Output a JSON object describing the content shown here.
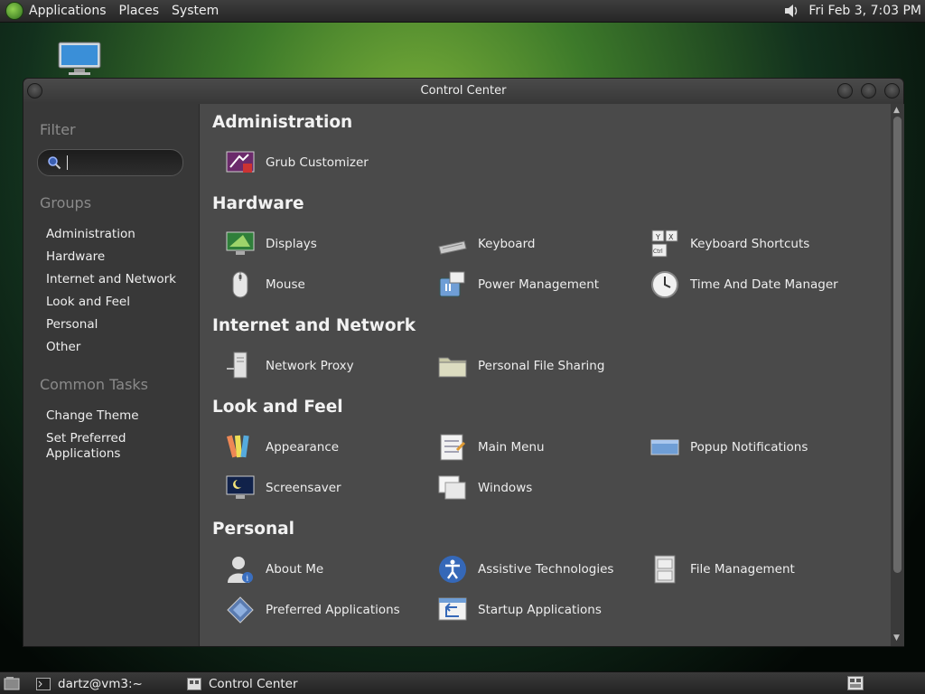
{
  "top_panel": {
    "menus": [
      "Applications",
      "Places",
      "System"
    ],
    "clock": "Fri Feb  3, 7:03 PM",
    "icons": [
      "gnome-foot-icon",
      "volume-icon"
    ]
  },
  "window": {
    "title": "Control Center"
  },
  "sidebar": {
    "filter_label": "Filter",
    "search_value": "",
    "groups_label": "Groups",
    "groups": [
      "Administration",
      "Hardware",
      "Internet and Network",
      "Look and Feel",
      "Personal",
      "Other"
    ],
    "common_label": "Common Tasks",
    "tasks": [
      "Change Theme",
      "Set Preferred Applications"
    ]
  },
  "sections": [
    {
      "title": "Administration",
      "items": [
        {
          "label": "Grub Customizer",
          "icon": "grub-customizer-icon"
        }
      ]
    },
    {
      "title": "Hardware",
      "items": [
        {
          "label": "Displays",
          "icon": "displays-icon"
        },
        {
          "label": "Keyboard",
          "icon": "keyboard-icon"
        },
        {
          "label": "Keyboard Shortcuts",
          "icon": "keyboard-shortcuts-icon"
        },
        {
          "label": "Mouse",
          "icon": "mouse-icon"
        },
        {
          "label": "Power Management",
          "icon": "power-management-icon"
        },
        {
          "label": "Time And Date Manager",
          "icon": "clock-icon"
        }
      ]
    },
    {
      "title": "Internet and Network",
      "items": [
        {
          "label": "Network Proxy",
          "icon": "network-proxy-icon"
        },
        {
          "label": "Personal File Sharing",
          "icon": "folder-share-icon"
        }
      ]
    },
    {
      "title": "Look and Feel",
      "items": [
        {
          "label": "Appearance",
          "icon": "appearance-icon"
        },
        {
          "label": "Main Menu",
          "icon": "main-menu-icon"
        },
        {
          "label": "Popup Notifications",
          "icon": "popup-notifications-icon"
        },
        {
          "label": "Screensaver",
          "icon": "screensaver-icon"
        },
        {
          "label": "Windows",
          "icon": "windows-icon"
        }
      ]
    },
    {
      "title": "Personal",
      "items": [
        {
          "label": "About Me",
          "icon": "about-me-icon"
        },
        {
          "label": "Assistive Technologies",
          "icon": "accessibility-icon"
        },
        {
          "label": "File Management",
          "icon": "file-cabinet-icon"
        },
        {
          "label": "Preferred Applications",
          "icon": "preferred-apps-icon"
        },
        {
          "label": "Startup Applications",
          "icon": "startup-apps-icon"
        }
      ]
    }
  ],
  "taskbar": {
    "tasks": [
      "dartz@vm3:~",
      "Control Center"
    ]
  }
}
